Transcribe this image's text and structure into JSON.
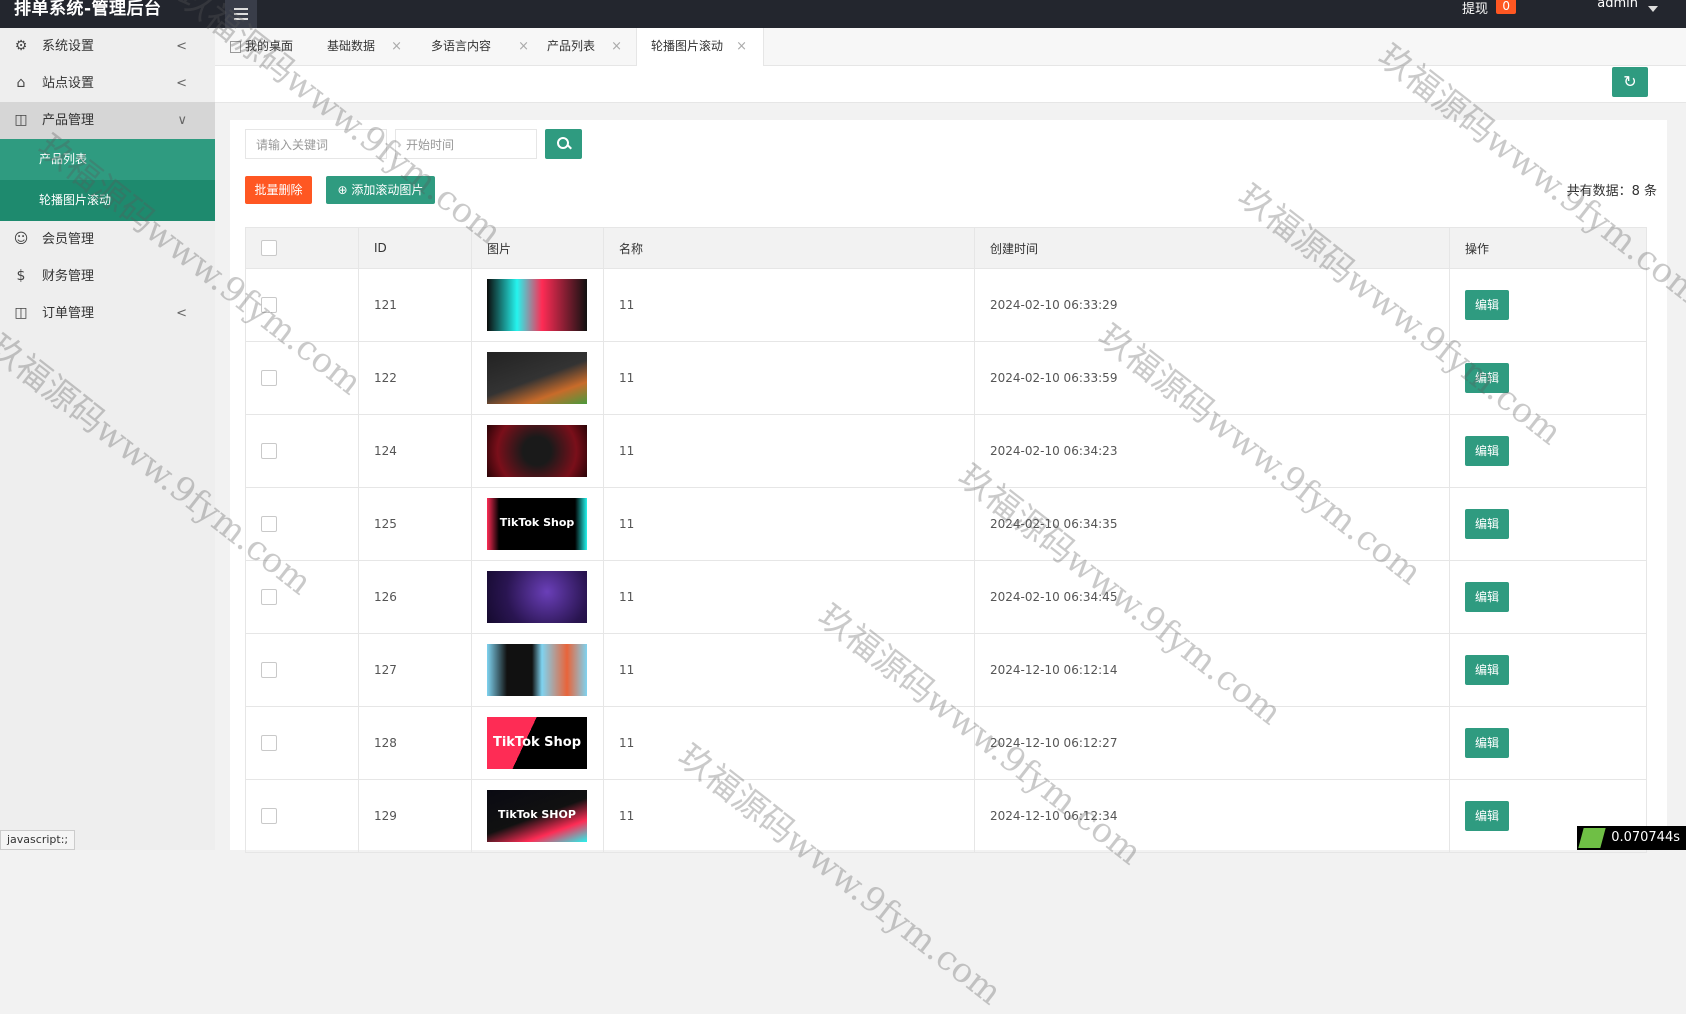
{
  "app": {
    "title": "排单系统-管理后台"
  },
  "header": {
    "withdraw_label": "提现",
    "withdraw_count": "0",
    "user": "admin"
  },
  "sidebar": {
    "items": [
      {
        "label": "系统设置",
        "icon": "gear-icon",
        "chevron": "<"
      },
      {
        "label": "站点设置",
        "icon": "site-icon",
        "chevron": "<"
      },
      {
        "label": "产品管理",
        "icon": "box-icon",
        "chevron": "∨",
        "children": [
          {
            "label": "产品列表"
          },
          {
            "label": "轮播图片滚动"
          }
        ]
      },
      {
        "label": "会员管理",
        "icon": "user-icon"
      },
      {
        "label": "财务管理",
        "icon": "dollar-icon"
      },
      {
        "label": "订单管理",
        "icon": "box-icon",
        "chevron": "<"
      }
    ]
  },
  "tabs": [
    {
      "label": "我的桌面"
    },
    {
      "label": "基础数据",
      "close": "×"
    },
    {
      "label": "多语言内容",
      "close": "×"
    },
    {
      "label": "产品列表",
      "close": "×"
    },
    {
      "label": "轮播图片滚动",
      "close": "×"
    }
  ],
  "toolbar": {
    "keyword_placeholder": "请输入关键词",
    "start_time_placeholder": "开始时间",
    "batch_delete": "批量删除",
    "add_slide": "添加滚动图片",
    "total": "共有数据：8 条"
  },
  "table": {
    "headers": [
      "ID",
      "图片",
      "名称",
      "创建时间",
      "操作"
    ],
    "edit_label": "编辑",
    "rows": [
      {
        "id": "121",
        "name": "11",
        "created": "2024-02-10 06:33:29"
      },
      {
        "id": "122",
        "name": "11",
        "created": "2024-02-10 06:33:59"
      },
      {
        "id": "124",
        "name": "11",
        "created": "2024-02-10 06:34:23"
      },
      {
        "id": "125",
        "name": "11",
        "created": "2024-02-10 06:34:35",
        "thumb_text": "TikTok Shop"
      },
      {
        "id": "126",
        "name": "11",
        "created": "2024-02-10 06:34:45"
      },
      {
        "id": "127",
        "name": "11",
        "created": "2024-12-10 06:12:14"
      },
      {
        "id": "128",
        "name": "11",
        "created": "2024-12-10 06:12:27",
        "thumb_text": "TikTok Shop"
      },
      {
        "id": "129",
        "name": "11",
        "created": "2024-12-10 06:12:34",
        "thumb_text": "TikTok SHOP"
      }
    ]
  },
  "watermark": "玖福源码www.9fym.com",
  "status": {
    "tip": "javascript:;",
    "timer": "0.070744s"
  },
  "colors": {
    "primary": "#2f9b80",
    "danger": "#ff5722",
    "topbar": "#23262e"
  }
}
